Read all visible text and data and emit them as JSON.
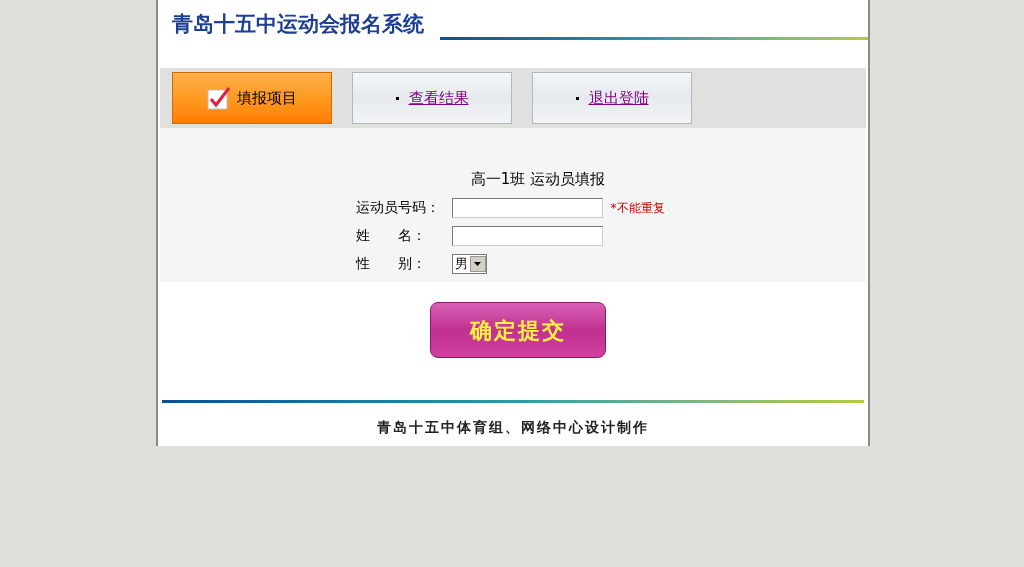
{
  "header": {
    "title": "青岛十五中运动会报名系统"
  },
  "tabs": [
    {
      "label": "填报项目",
      "selected": true
    },
    {
      "label": "查看结果",
      "selected": false
    },
    {
      "label": "退出登陆",
      "selected": false
    }
  ],
  "form": {
    "heading": "高一1班 运动员填报",
    "fields": [
      {
        "kind": "input",
        "label": "运动员号码：",
        "note": "*不能重复"
      },
      {
        "kind": "input",
        "label": "姓　　名："
      },
      {
        "kind": "select",
        "label": "性　　别：",
        "value": "男"
      }
    ]
  },
  "submit_button": "确定提交",
  "footer": "青岛十五中体育组、网络中心设计制作"
}
